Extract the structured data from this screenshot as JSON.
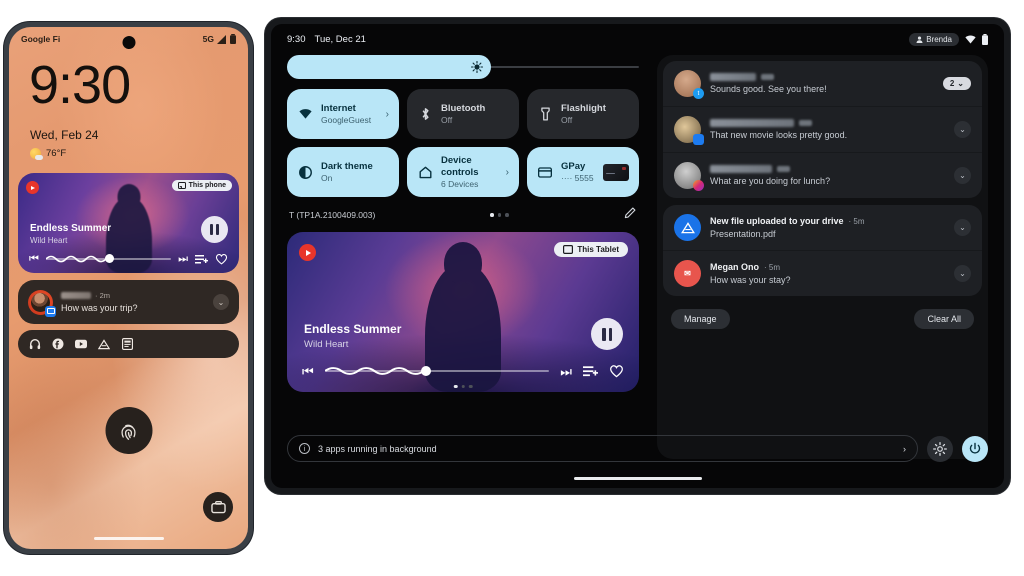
{
  "phone": {
    "status": {
      "carrier": "Google Fi",
      "network": "5G",
      "signal_icon": "signal-icon",
      "battery_icon": "battery-icon"
    },
    "lockscreen": {
      "clock": "9:30",
      "date": "Wed, Feb 24",
      "weather": "76°F",
      "weather_icon": "partly-sunny-icon"
    },
    "media": {
      "app_icon": "youtube-music-icon",
      "output_chip": "This phone",
      "output_icon": "cast-icon",
      "title": "Endless Summer",
      "artist": "Wild Heart",
      "play_state_icon": "pause-icon",
      "prev_icon": "skip-previous-icon",
      "next_icon": "skip-next-icon",
      "queue_icon": "add-to-queue-icon",
      "favorite_icon": "heart-icon",
      "progress_percent": 47
    },
    "notification": {
      "sender": "",
      "sender_redacted": true,
      "time": "· 2m",
      "body": "How was your trip?",
      "expand_icon": "chevron-down-icon",
      "app_badge_icon": "messages-icon"
    },
    "app_row": [
      "headphones-icon",
      "facebook-icon",
      "youtube-icon",
      "drive-icon",
      "news-icon"
    ],
    "fingerprint_icon": "fingerprint-icon",
    "wallet_icon": "wallet-icon"
  },
  "tablet": {
    "status": {
      "time": "9:30",
      "date": "Tue, Dec 21",
      "user": "Brenda",
      "user_icon": "person-icon",
      "wifi_icon": "wifi-icon",
      "battery_icon": "battery-icon"
    },
    "brightness": {
      "label": "brightness",
      "icon": "brightness-icon",
      "value_percent": 58
    },
    "tiles": [
      {
        "name": "internet",
        "label": "Internet",
        "sub": "GoogleGuest",
        "icon": "wifi-icon",
        "state": "on",
        "arrow": "›"
      },
      {
        "name": "bluetooth",
        "label": "Bluetooth",
        "sub": "Off",
        "icon": "bluetooth-icon",
        "state": "off",
        "arrow": ""
      },
      {
        "name": "flashlight",
        "label": "Flashlight",
        "sub": "Off",
        "icon": "flashlight-icon",
        "state": "off",
        "arrow": ""
      },
      {
        "name": "dark-theme",
        "label": "Dark theme",
        "sub": "On",
        "icon": "contrast-icon",
        "state": "on",
        "arrow": ""
      },
      {
        "name": "device-controls",
        "label": "Device controls",
        "sub": "6 Devices",
        "icon": "home-icon",
        "state": "on",
        "arrow": "›"
      },
      {
        "name": "gpay",
        "label": "GPay",
        "sub": "···· 5555",
        "icon": "credit-card-icon",
        "state": "on",
        "arrow": ""
      }
    ],
    "build": "T (TP1A.2100409.003)",
    "page_dots": 3,
    "active_dot": 0,
    "edit_icon": "pencil-icon",
    "media": {
      "app_icon": "youtube-music-icon",
      "output_chip": "This Tablet",
      "output_icon": "tablet-icon",
      "title": "Endless Summer",
      "artist": "Wild Heart",
      "play_state_icon": "pause-icon",
      "prev_icon": "skip-previous-icon",
      "next_icon": "skip-next-icon",
      "queue_icon": "add-to-queue-icon",
      "favorite_icon": "heart-icon",
      "progress_percent": 45,
      "page_dots": 3,
      "active_dot": 0
    },
    "bottom": {
      "background_apps": "3 apps running in background",
      "info_icon": "info-icon",
      "arrow": "›",
      "settings_icon": "gear-icon",
      "power_icon": "power-icon"
    },
    "notifications": {
      "groups": [
        {
          "items": [
            {
              "name": "conversation-eunie",
              "sender": "Eunie Park",
              "sender_redacted": true,
              "time": "· 2m",
              "body": "Sounds good. See you there!",
              "app_badge_icon": "twitter-icon",
              "count_pill": "2",
              "expand_icon": "chevron-down-icon"
            },
            {
              "name": "conversation-florian",
              "sender": "Florian Koenigsberger",
              "sender_redacted": true,
              "time": "· 2m",
              "body": "That new movie looks pretty good.",
              "app_badge_icon": "messages-icon",
              "count_pill": "",
              "expand_icon": "chevron-down-icon"
            },
            {
              "name": "conversation-patrick",
              "sender": "Patrick Hoelzer",
              "sender_redacted": true,
              "time": "· 3m",
              "body": "What are you doing for lunch?",
              "app_badge_icon": "instagram-icon",
              "count_pill": "",
              "expand_icon": "chevron-down-icon"
            }
          ]
        },
        {
          "items": [
            {
              "name": "notification-drive",
              "sender": "New file uploaded to your drive",
              "sender_redacted": false,
              "time": "· 5m",
              "body": "Presentation.pdf",
              "app_badge_icon": "drive-icon",
              "count_pill": "",
              "expand_icon": "chevron-down-icon"
            },
            {
              "name": "notification-megan",
              "sender": "Megan Ono",
              "sender_redacted": false,
              "time": "· 5m",
              "body": "How was your stay?",
              "app_badge_icon": "mail-icon",
              "count_pill": "",
              "expand_icon": "chevron-down-icon"
            }
          ]
        }
      ],
      "manage_label": "Manage",
      "clear_all_label": "Clear All"
    }
  },
  "colors": {
    "accent": "#b9e6f7",
    "tile_off": "#26282c",
    "shade_bg": "#101113",
    "notif_card": "#1e2024",
    "phone_wallpaper": "#e59a70"
  }
}
